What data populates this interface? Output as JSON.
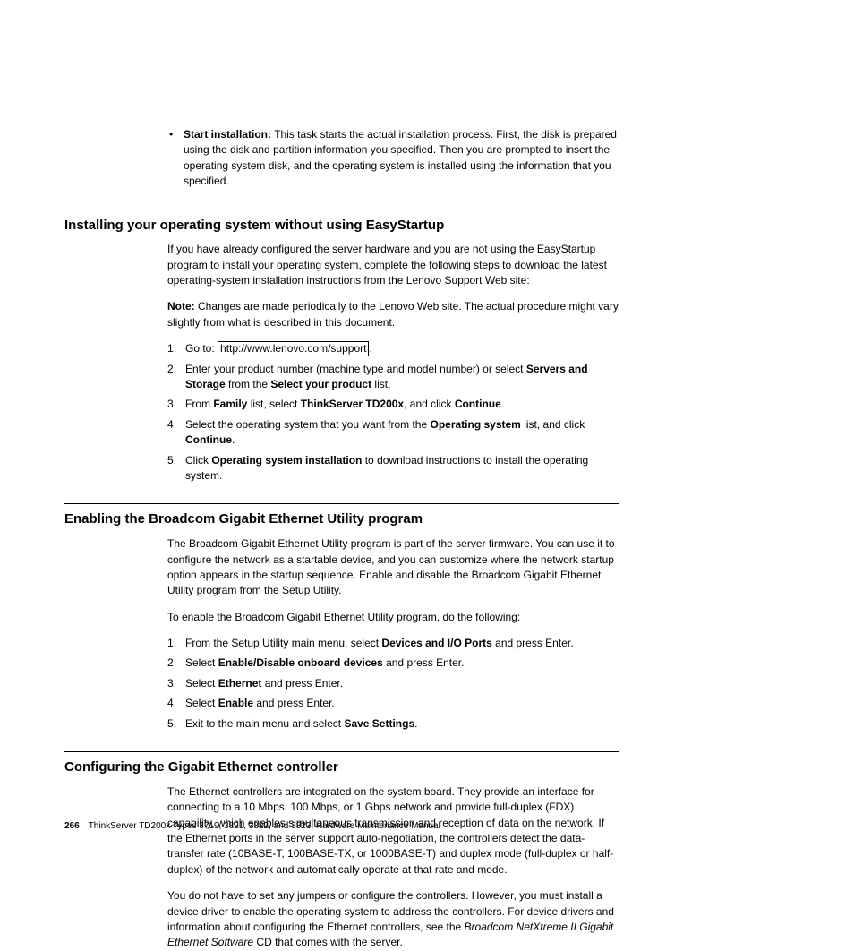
{
  "bullet": {
    "label": "Start installation:",
    "text": " This task starts the actual installation process. First, the disk is prepared using the disk and partition information you specified. Then you are prompted to insert the operating system disk, and the operating system is installed using the information that you specified."
  },
  "s1": {
    "title": "Installing your operating system without using EasyStartup",
    "intro": "If you have already configured the server hardware and you are not using the EasyStartup program to install your operating system, complete the following steps to download the latest operating-system installation instructions from the Lenovo Support Web site:",
    "note_label": "Note:",
    "note_text": "  Changes are made periodically to the Lenovo Web site. The actual procedure might vary slightly from what is described in this document.",
    "steps": {
      "s1a": "Go to: ",
      "s1b": "http://www.lenovo.com/support",
      "s1c": ".",
      "s2a": "Enter your product number (machine type and model number) or select ",
      "s2b": "Servers and Storage",
      "s2c": " from the ",
      "s2d": "Select your product",
      "s2e": " list.",
      "s3a": "From ",
      "s3b": "Family",
      "s3c": " list, select ",
      "s3d": "ThinkServer TD200x",
      "s3e": ", and click ",
      "s3f": "Continue",
      "s3g": ".",
      "s4a": "Select the operating system that you want from the ",
      "s4b": "Operating system",
      "s4c": " list, and click ",
      "s4d": "Continue",
      "s4e": ".",
      "s5a": "Click ",
      "s5b": "Operating system installation",
      "s5c": " to download instructions to install the operating system."
    }
  },
  "s2": {
    "title": "Enabling the Broadcom Gigabit Ethernet Utility program",
    "intro": "The Broadcom Gigabit Ethernet Utility program is part of the server firmware. You can use it to configure the network as a startable device, and you can customize where the network startup option appears in the startup sequence. Enable and disable the Broadcom Gigabit Ethernet Utility program from the Setup Utility.",
    "lead": "To enable the Broadcom Gigabit Ethernet Utility program, do the following:",
    "steps": {
      "s1a": "From the Setup Utility main menu, select ",
      "s1b": "Devices and I/O Ports",
      "s1c": " and press Enter.",
      "s2a": "Select ",
      "s2b": "Enable/Disable onboard devices",
      "s2c": " and press Enter.",
      "s3a": "Select ",
      "s3b": "Ethernet",
      "s3c": " and press Enter.",
      "s4a": "Select ",
      "s4b": "Enable",
      "s4c": " and press Enter.",
      "s5a": "Exit to the main menu and select ",
      "s5b": "Save Settings",
      "s5c": "."
    }
  },
  "s3": {
    "title": "Configuring the Gigabit Ethernet controller",
    "p1": "The Ethernet controllers are integrated on the system board. They provide an interface for connecting to a 10 Mbps, 100 Mbps, or 1 Gbps network and provide full-duplex (FDX) capability, which enables simultaneous transmission and reception of data on the network. If the Ethernet ports in the server support auto-negotiation, the controllers detect the data-transfer rate (10BASE-T, 100BASE-TX, or 1000BASE-T) and duplex mode (full-duplex or half-duplex) of the network and automatically operate at that rate and mode.",
    "p2a": "You do not have to set any jumpers or configure the controllers. However, you must install a device driver to enable the operating system to address the controllers. For device drivers and information about configuring the Ethernet controllers, see the ",
    "p2b": "Broadcom NetXtreme II Gigabit Ethernet Software",
    "p2c": " CD that comes with the server."
  },
  "footer": {
    "page": "266",
    "text": "ThinkServer TD200x Types 3719, 3821, 3822, and 3823:  Hardware Maintenance Manual"
  }
}
